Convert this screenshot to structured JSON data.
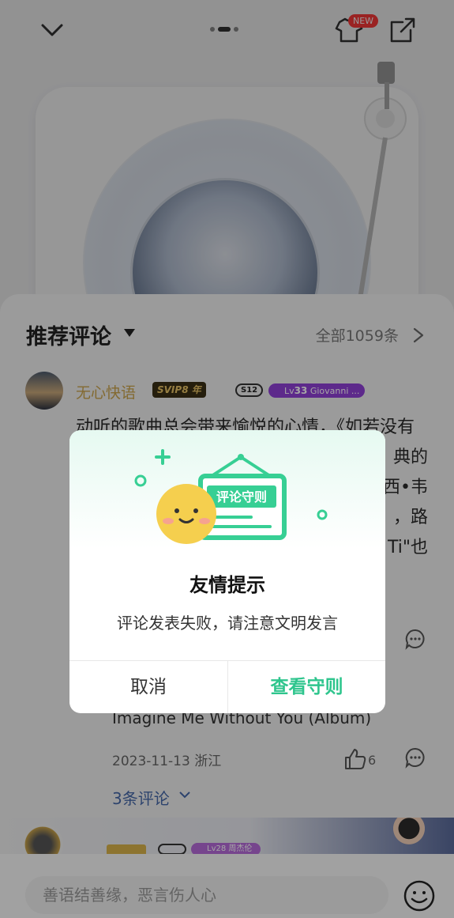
{
  "header": {
    "new_badge": "NEW",
    "pager": {
      "count": 3,
      "active": 2
    }
  },
  "sheet": {
    "title": "推荐评论",
    "all_count": "全部1059条"
  },
  "comment": {
    "username": "无心快语",
    "vip_badge": "SVIP8 年",
    "s12_badge": "S12",
    "level_prefix": "Lv",
    "level_num": "33",
    "level_name": "Giovanni ...",
    "text_line1": "动听的歌曲总会带来愉悦的心情，《如若没有",
    "text_line2_right": "典的",
    "text_line3_right": "西•韦",
    "text_line4_right": "，路",
    "text_line5_right": "Ti\"也",
    "album_line": "Imagine Me Without You (Album)",
    "date_location": "2023-11-13 浙江",
    "like_count": "6",
    "replies": "3条评论"
  },
  "next_comment": {
    "level": "Lv28",
    "level_name": "周杰伦"
  },
  "bottom_bar": {
    "input_placeholder": "善语结善缘，恶言伤人心"
  },
  "dialog": {
    "illustration_sign": "评论守则",
    "title": "友情提示",
    "message": "评论发表失败，请注意文明发言",
    "cancel_label": "取消",
    "confirm_label": "查看守则",
    "accent_color": "#2ec58d"
  }
}
